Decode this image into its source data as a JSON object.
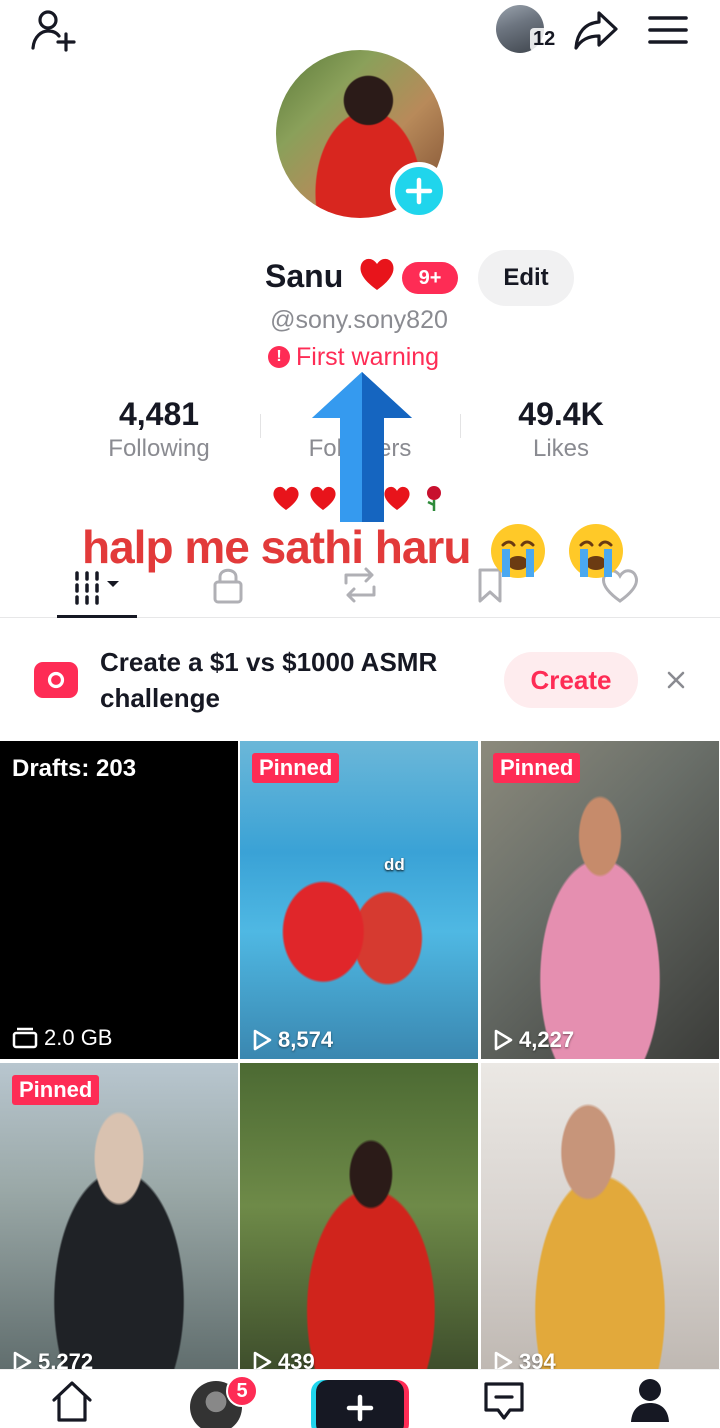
{
  "header": {
    "mini_avatar_count": "12"
  },
  "profile": {
    "name": "Sanu",
    "notification_badge": "9+",
    "edit_label": "Edit",
    "handle": "@sony.sony820",
    "warning_text": "First warning"
  },
  "stats": {
    "following_count": "4,481",
    "following_label": "Following",
    "followers_label": "Followers",
    "likes_count": "49.4K",
    "likes_label": "Likes"
  },
  "overlay": {
    "text": "halp me sathi haru"
  },
  "promo": {
    "text": "Create a $1 vs $1000 ASMR challenge",
    "button_label": "Create"
  },
  "grid": {
    "drafts_label": "Drafts: 203",
    "drafts_size": "2.0 GB",
    "pinned_label": "Pinned",
    "items": [
      {
        "views": "8,574",
        "caption": "dd"
      },
      {
        "views": "4,227"
      },
      {
        "views": "5,272"
      },
      {
        "views": "439"
      },
      {
        "views": "394"
      }
    ]
  },
  "bottom_nav": {
    "inbox_badge": "5"
  },
  "colors": {
    "accent": "#fe2c55",
    "cyan": "#20d5ec",
    "text": "#161823",
    "muted": "#8a8b91"
  },
  "icons": [
    "add-friend-icon",
    "share-icon",
    "menu-icon",
    "plus-icon",
    "heart-icon",
    "warning-icon",
    "videos-tab-icon",
    "lock-icon",
    "repost-icon",
    "bookmark-icon",
    "liked-icon",
    "camera-icon",
    "close-icon",
    "play-icon",
    "storage-icon",
    "home-icon",
    "inbox-icon",
    "profile-icon"
  ]
}
